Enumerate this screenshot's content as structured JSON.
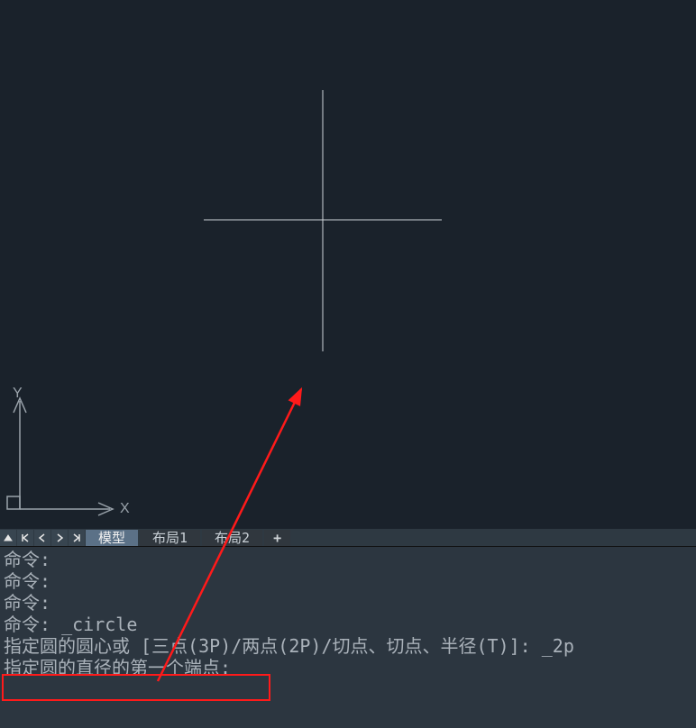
{
  "ucs": {
    "x_label": "X",
    "y_label": "Y"
  },
  "tabs": {
    "model": "模型",
    "layout1": "布局1",
    "layout2": "布局2",
    "plus": "+"
  },
  "console": {
    "l1": "命令:",
    "l2": "命令:",
    "l3": "命令:",
    "l4_prefix": "命令: ",
    "l4_cmd": "_circle",
    "l5": "指定圆的圆心或 [三点(3P)/两点(2P)/切点、切点、半径(T)]: _2p",
    "l6": "指定圆的直径的第一个端点:"
  }
}
